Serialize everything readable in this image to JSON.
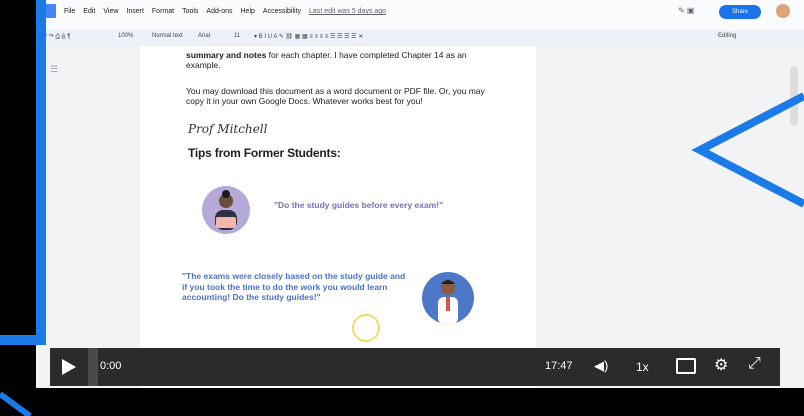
{
  "docs": {
    "menu": [
      "File",
      "Edit",
      "View",
      "Insert",
      "Format",
      "Tools",
      "Add-ons",
      "Help",
      "Accessibility"
    ],
    "last_edit": "Last edit was 5 days ago",
    "share_label": "Share",
    "toolbar": {
      "zoom": "100%",
      "style": "Normal text",
      "font": "Arial",
      "size": "11",
      "mode": "Editing"
    }
  },
  "document": {
    "para1_rest": "summary and notes",
    "para1_tail": " for each chapter.  I have completed Chapter 14 as an example.",
    "para2": "You may download this document as a word document or PDF file.  Or, you may copy it in your own Google Docs.  Whatever works best for you!",
    "signature": "Prof Mitchell",
    "tips_heading": "Tips from Former Students:",
    "quote1": "\"Do the study guides before every exam!\"",
    "quote2": "\"The exams were closely based on the study guide and if you took the time to do the work you would learn accounting! Do the study guides!\""
  },
  "player": {
    "current_time": "0:00",
    "total_time": "17:47",
    "speed": "1x",
    "progress_fraction": 0
  },
  "colors": {
    "accent_blue": "#1a7ae8",
    "quote1": "#7b6fb5",
    "quote2": "#4a72c6",
    "control_bar": "#2b2b2b"
  }
}
